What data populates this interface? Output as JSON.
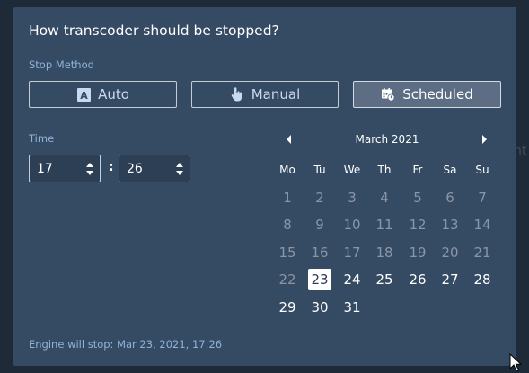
{
  "background_text": "nt",
  "dialog": {
    "title": "How transcoder should be stopped?",
    "stop_method_label": "Stop Method",
    "methods": [
      {
        "label": "Auto",
        "icon": "auto-a-icon",
        "active": false
      },
      {
        "label": "Manual",
        "icon": "hand-pointer-icon",
        "active": false
      },
      {
        "label": "Scheduled",
        "icon": "calendar-clock-icon",
        "active": true
      }
    ],
    "time_label": "Time",
    "hour": "17",
    "minute": "26",
    "separator": ":",
    "calendar": {
      "month_title": "March 2021",
      "weekdays": [
        "Mo",
        "Tu",
        "We",
        "Th",
        "Fr",
        "Sa",
        "Su"
      ],
      "weeks": [
        [
          "1",
          "2",
          "3",
          "4",
          "5",
          "6",
          "7"
        ],
        [
          "8",
          "9",
          "10",
          "11",
          "12",
          "13",
          "14"
        ],
        [
          "15",
          "16",
          "17",
          "18",
          "19",
          "20",
          "21"
        ],
        [
          "22",
          "23",
          "24",
          "25",
          "26",
          "27",
          "28"
        ],
        [
          "29",
          "30",
          "31"
        ]
      ],
      "selected_day": "23",
      "first_enabled_day": "24"
    },
    "footer": "Engine will stop: Mar 23, 2021, 17:26"
  },
  "colors": {
    "page_bg": "#1f2a38",
    "dialog_bg": "#354a63",
    "label_blue": "#8fb3d9",
    "active_button": "#5d6e84",
    "disabled_day": "#8a96a6"
  }
}
